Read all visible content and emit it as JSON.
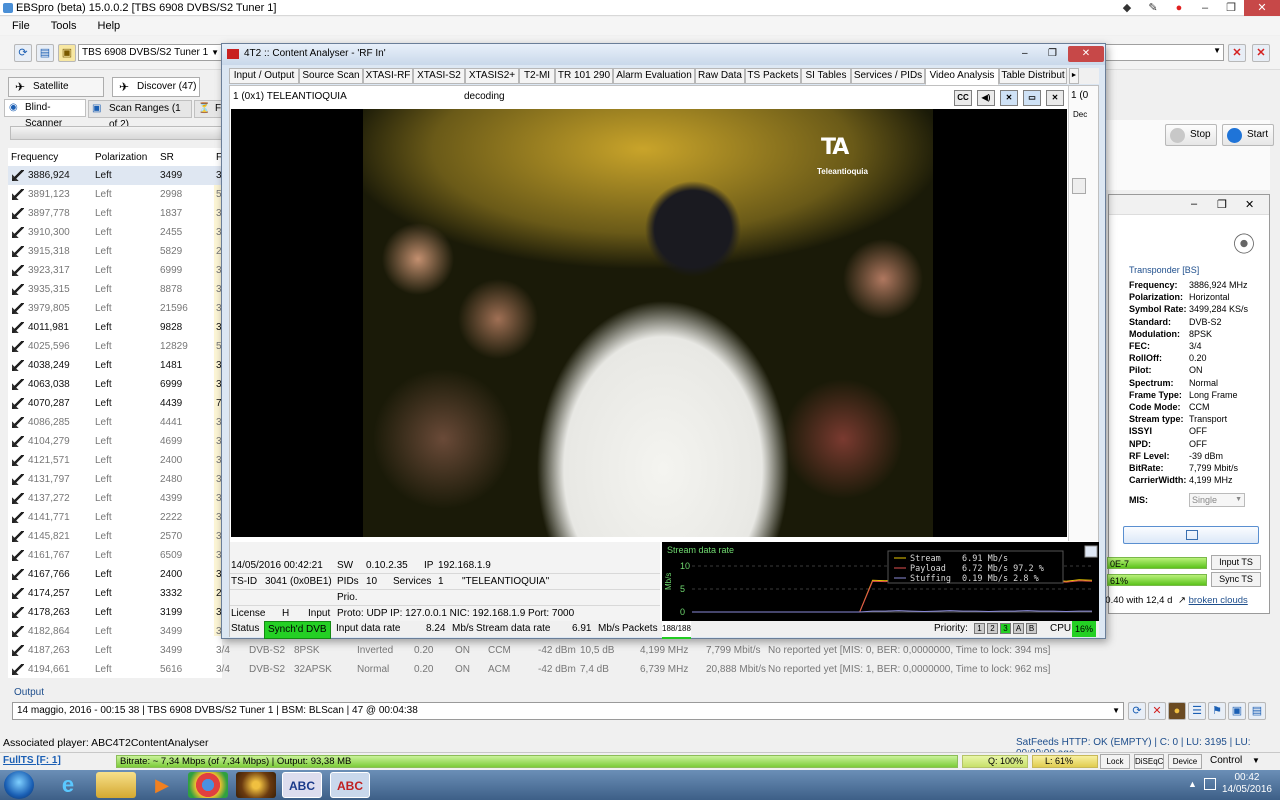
{
  "window": {
    "title": "EBSpro (beta) 15.0.0.2 [TBS 6908 DVBS/S2 Tuner 1]"
  },
  "menu": [
    "File",
    "Tools",
    "Help"
  ],
  "toolbar": {
    "tuner": "TBS 6908 DVBS/S2 Tuner 1"
  },
  "tabs": {
    "satellite": "Satellite (40.5W)",
    "discover": "Discover (47)"
  },
  "subtabs": {
    "blind": "Blind-Scanner",
    "ranges": "Scan Ranges (1 of 2)",
    "fil": "Fil"
  },
  "grid": {
    "headers": [
      "Frequency (MHz)",
      "Polarization",
      "SR (KS/s)",
      "F"
    ],
    "rows": [
      {
        "freq": "3886,924",
        "pol": "Left",
        "sr": "3499",
        "f": "3",
        "bold": true,
        "sel": true
      },
      {
        "freq": "3891,123",
        "pol": "Left",
        "sr": "2998",
        "f": "5"
      },
      {
        "freq": "3897,778",
        "pol": "Left",
        "sr": "1837",
        "f": "3"
      },
      {
        "freq": "3910,300",
        "pol": "Left",
        "sr": "2455",
        "f": "3"
      },
      {
        "freq": "3915,318",
        "pol": "Left",
        "sr": "5829",
        "f": "2"
      },
      {
        "freq": "3923,317",
        "pol": "Left",
        "sr": "6999",
        "f": "3"
      },
      {
        "freq": "3935,315",
        "pol": "Left",
        "sr": "8878",
        "f": "3"
      },
      {
        "freq": "3979,805",
        "pol": "Left",
        "sr": "21596",
        "f": "3"
      },
      {
        "freq": "4011,981",
        "pol": "Left",
        "sr": "9828",
        "f": "3",
        "bold": true
      },
      {
        "freq": "4025,596",
        "pol": "Left",
        "sr": "12829",
        "f": "5"
      },
      {
        "freq": "4038,249",
        "pol": "Left",
        "sr": "1481",
        "f": "3",
        "bold": true
      },
      {
        "freq": "4063,038",
        "pol": "Left",
        "sr": "6999",
        "f": "3",
        "bold": true
      },
      {
        "freq": "4070,287",
        "pol": "Left",
        "sr": "4439",
        "f": "7",
        "bold": true
      },
      {
        "freq": "4086,285",
        "pol": "Left",
        "sr": "4441",
        "f": "3"
      },
      {
        "freq": "4104,279",
        "pol": "Left",
        "sr": "4699",
        "f": "3"
      },
      {
        "freq": "4121,571",
        "pol": "Left",
        "sr": "2400",
        "f": "3"
      },
      {
        "freq": "4131,797",
        "pol": "Left",
        "sr": "2480",
        "f": "3"
      },
      {
        "freq": "4137,272",
        "pol": "Left",
        "sr": "4399",
        "f": "3"
      },
      {
        "freq": "4141,771",
        "pol": "Left",
        "sr": "2222",
        "f": "3"
      },
      {
        "freq": "4145,821",
        "pol": "Left",
        "sr": "2570",
        "f": "3"
      },
      {
        "freq": "4161,767",
        "pol": "Left",
        "sr": "6509",
        "f": "3"
      },
      {
        "freq": "4167,766",
        "pol": "Left",
        "sr": "2400",
        "f": "3",
        "bold": true
      },
      {
        "freq": "4174,257",
        "pol": "Left",
        "sr": "3332",
        "f": "2",
        "bold": true
      },
      {
        "freq": "4178,263",
        "pol": "Left",
        "sr": "3199",
        "f": "3",
        "bold": true
      },
      {
        "freq": "4182,864",
        "pol": "Left",
        "sr": "3499",
        "f": "3"
      },
      {
        "freq": "4187,263",
        "pol": "Left",
        "sr": "3499",
        "f": "3/4",
        "std": "DVB-S2",
        "mod": "8PSK",
        "inv": "Inverted",
        "ro": "0.20",
        "pilot": "ON",
        "cm": "CCM",
        "lvl": "-42 dBm",
        "cn": "10,5 dB",
        "cw": "4,199 MHz",
        "br": "7,799 Mbit/s",
        "note": "No reported yet [MIS: 0, BER: 0,0000000, Time to lock: 394 ms]"
      },
      {
        "freq": "4194,661",
        "pol": "Left",
        "sr": "5616",
        "f": "3/4",
        "std": "DVB-S2",
        "mod": "32APSK",
        "inv": "Normal",
        "ro": "0.20",
        "pilot": "ON",
        "cm": "ACM",
        "lvl": "-42 dBm",
        "cn": "7,4 dB",
        "cw": "6,739 MHz",
        "br": "20,888 Mbit/s",
        "note": "No reported yet [MIS: 1, BER: 0,0000000, Time to lock: 962 ms]"
      }
    ]
  },
  "controls": {
    "stop": "Stop",
    "start": "Start"
  },
  "transponder": {
    "heading": "Transponder [BS]",
    "fields": [
      [
        "Frequency:",
        "3886,924 MHz"
      ],
      [
        "Polarization:",
        "Horizontal"
      ],
      [
        "Symbol Rate:",
        "3499,284 KS/s"
      ],
      [
        "Standard:",
        "DVB-S2"
      ],
      [
        "Modulation:",
        "8PSK"
      ],
      [
        "FEC:",
        "3/4"
      ],
      [
        "RollOff:",
        "0.20"
      ],
      [
        "Pilot:",
        "ON"
      ],
      [
        "Spectrum:",
        "Normal"
      ],
      [
        "Frame Type:",
        "Long Frame"
      ],
      [
        "Code Mode:",
        "CCM"
      ],
      [
        "Stream type:",
        "Transport"
      ],
      [
        "ISSYI",
        "OFF"
      ],
      [
        "NPD:",
        "OFF"
      ],
      [
        "RF Level:",
        "-39 dBm"
      ],
      [
        "BitRate:",
        "7,799 Mbit/s"
      ],
      [
        "CarrierWidth:",
        "4,199 MHz"
      ]
    ],
    "mis_label": "MIS:",
    "mis_value": "Single",
    "bar1": "0E-7",
    "bar2": "61%",
    "input_ts": "Input TS",
    "sync_ts": "Sync TS",
    "broken_prefix": "00.40 with 12,4 d",
    "broken_link": "broken clouds"
  },
  "analyser": {
    "title": "4T2 :: Content Analyser - 'RF In'",
    "tabs": [
      "Input / Output",
      "Source Scan",
      "XTASI-RF",
      "XTASI-S2",
      "XTASIS2+",
      "T2-MI",
      "TR 101 290",
      "Alarm Evaluation",
      "Raw Data",
      "TS Packets",
      "SI Tables",
      "Services / PIDs",
      "Video Analysis",
      "Table Distribut"
    ],
    "active_tab": "Video Analysis",
    "service": "1 (0x1) TELEANTIOQUIA",
    "state": "decoding",
    "strip_top": "1 (0",
    "strip_sub": "Dec",
    "logo_text": "Teleantioquia",
    "info": {
      "date": "14/05/2016 00:42:21",
      "sw_label": "SW",
      "sw": "0.10.2.35",
      "ip_label": "IP",
      "ip": "192.168.1.9",
      "tsid_label": "TS-ID",
      "tsid": "3041 (0x0BE1)",
      "pids_label": "PIDs",
      "pids": "10",
      "services_label": "Services",
      "services": "1",
      "svc_name": "\"TELEANTIOQUIA\"",
      "prio": "Prio.",
      "license_label": "License",
      "license": "H",
      "input_label": "Input",
      "input": "Proto: UDP IP: 127.0.0.1 NIC: 192.168.1.9 Port: 7000"
    },
    "status": {
      "label": "Status",
      "synch": "Synch'd DVB",
      "idr_label": "Input data rate",
      "idr": "8.24",
      "unit1": "Mb/s",
      "sdr_label": "Stream data rate",
      "sdr": "6.91",
      "unit2": "Mb/s",
      "packets_label": "Packets",
      "packets": "188/188",
      "priority_label": "Priority:",
      "prio_btns": [
        "1",
        "2",
        "3",
        "A",
        "B"
      ],
      "cpu_label": "CPU",
      "cpu": "16%"
    }
  },
  "chart_data": {
    "type": "line",
    "title": "Stream data rate",
    "ylabel": "Mb/s",
    "ylim": [
      0,
      10
    ],
    "yticks": [
      "10",
      "5",
      "0"
    ],
    "series": [
      {
        "name": "Stream",
        "value": "6.91 Mb/s",
        "color": "#e8c800",
        "values": [
          0,
          0,
          0,
          0,
          0,
          0,
          0,
          0,
          0,
          0,
          0,
          0,
          0,
          0,
          6.9,
          6.8,
          7.0,
          6.9,
          6.7,
          7.1,
          6.9,
          6.8,
          7.0,
          6.6,
          7.0,
          6.9,
          6.8,
          7.1,
          6.9,
          6.7,
          7.0,
          6.9
        ]
      },
      {
        "name": "Payload",
        "value": "6.72 Mb/s  97.2 %",
        "color": "#e05050",
        "values": [
          0,
          0,
          0,
          0,
          0,
          0,
          0,
          0,
          0,
          0,
          0,
          0,
          0,
          0,
          6.7,
          6.6,
          6.8,
          6.7,
          6.5,
          6.9,
          6.7,
          6.6,
          6.8,
          6.4,
          6.8,
          6.7,
          6.6,
          6.9,
          6.7,
          6.5,
          6.8,
          6.7
        ]
      },
      {
        "name": "Stuffing",
        "value": "0.19 Mb/s   2.8 %",
        "color": "#8a8ad8",
        "values": [
          0,
          0,
          0,
          0,
          0,
          0,
          0,
          0,
          0,
          0,
          0,
          0,
          0,
          0,
          0.2,
          0.2,
          0.3,
          0.2,
          0.1,
          0.2,
          0.3,
          0.2,
          0.2,
          0.1,
          0.2,
          0.2,
          0.3,
          0.2,
          0.2,
          0.1,
          0.2,
          0.2
        ]
      }
    ]
  },
  "output": {
    "label": "Output",
    "line": "14 maggio, 2016 - 00:15 38 | TBS 6908 DVBS/S2 Tuner 1 | BSM: BLScan | 47 @ 00:04:38"
  },
  "status": {
    "assoc": "Associated player: ABC4T2ContentAnalyser",
    "satfeeds": "SatFeeds HTTP: OK (EMPTY) | C: 0 | LU: 3195 | LU: 00:00:00 ago.",
    "fullts": "FullTS [F: 1]",
    "bitrate": "Bitrate: ~ 7,34 Mbps (of 7,34 Mbps) | Output: 93,38 MB",
    "q": "Q: 100%",
    "l": "L: 61%",
    "lock": "Lock",
    "diseqc": "DiSEqC",
    "device": "Device",
    "control": "Control"
  },
  "clock": {
    "time": "00:42",
    "date": "14/05/2016"
  }
}
